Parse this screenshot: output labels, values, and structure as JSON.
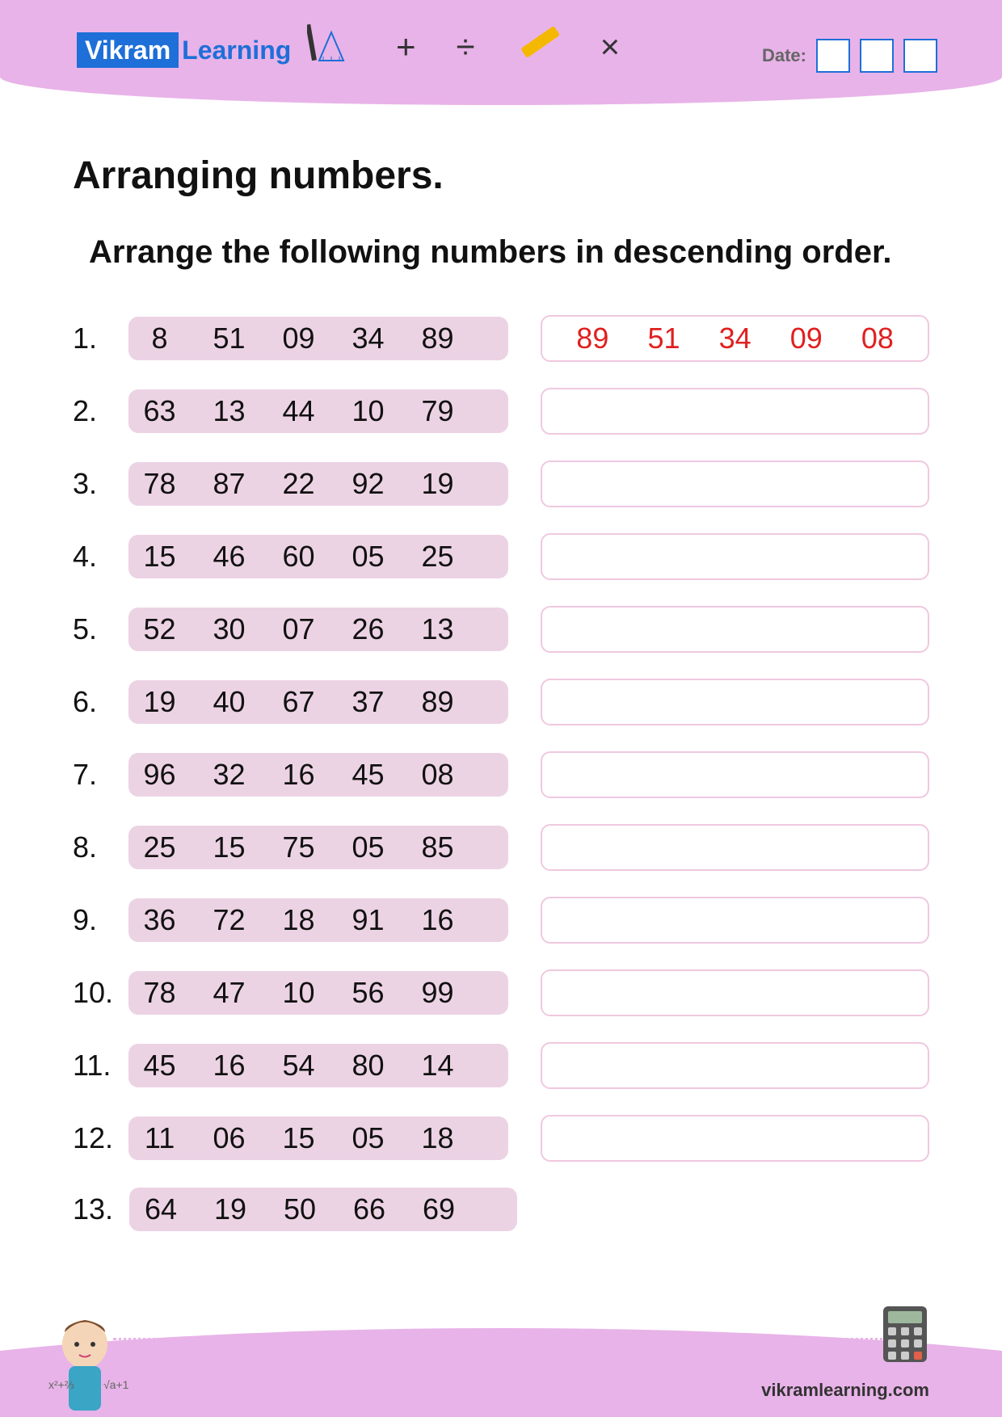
{
  "header": {
    "logo_part1": "Vikram",
    "logo_part2": "Learning",
    "symbols": [
      "+",
      "÷",
      "×"
    ],
    "date_label": "Date:"
  },
  "title": "Arranging numbers.",
  "instruction": "Arrange the following numbers in descending order.",
  "rows": [
    {
      "n": "1.",
      "vals": [
        "8",
        "51",
        "09",
        "34",
        "89"
      ],
      "answer": [
        "89",
        "51",
        "34",
        "09",
        "08"
      ]
    },
    {
      "n": "2.",
      "vals": [
        "63",
        "13",
        "44",
        "10",
        "79"
      ],
      "answer": null
    },
    {
      "n": "3.",
      "vals": [
        "78",
        "87",
        "22",
        "92",
        "19"
      ],
      "answer": null
    },
    {
      "n": "4.",
      "vals": [
        "15",
        "46",
        "60",
        "05",
        "25"
      ],
      "answer": null
    },
    {
      "n": "5.",
      "vals": [
        "52",
        "30",
        "07",
        "26",
        "13"
      ],
      "answer": null
    },
    {
      "n": "6.",
      "vals": [
        "19",
        "40",
        "67",
        "37",
        "89"
      ],
      "answer": null
    },
    {
      "n": "7.",
      "vals": [
        "96",
        "32",
        "16",
        "45",
        "08"
      ],
      "answer": null
    },
    {
      "n": "8.",
      "vals": [
        "25",
        "15",
        "75",
        "05",
        "85"
      ],
      "answer": null
    },
    {
      "n": "9.",
      "vals": [
        "36",
        "72",
        "18",
        "91",
        "16"
      ],
      "answer": null
    },
    {
      "n": "10.",
      "vals": [
        "78",
        "47",
        "10",
        "56",
        "99"
      ],
      "answer": null
    },
    {
      "n": "11.",
      "vals": [
        "45",
        "16",
        "54",
        "80",
        "14"
      ],
      "answer": null
    },
    {
      "n": "12.",
      "vals": [
        "11",
        "06",
        "15",
        "05",
        "18"
      ],
      "answer": null
    },
    {
      "n": "13.",
      "vals": [
        "64",
        "19",
        "50",
        "66",
        "69"
      ],
      "answer": null
    }
  ],
  "footer": {
    "url": "vikramlearning.com"
  }
}
